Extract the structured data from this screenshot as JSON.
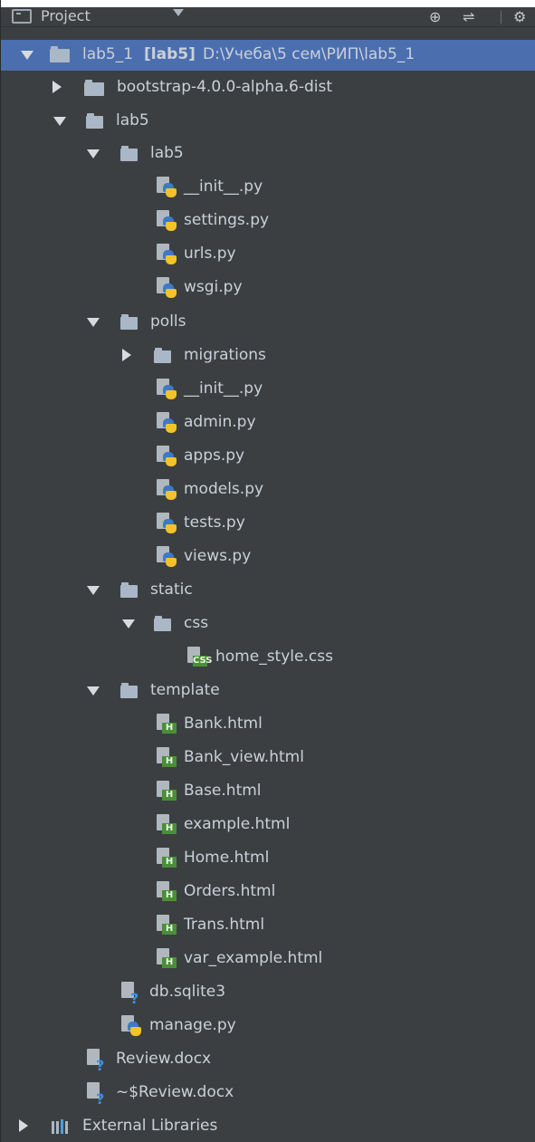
{
  "toolbar": {
    "title": "Project",
    "icons": [
      "target-icon",
      "filter-icon",
      "gear-icon"
    ]
  },
  "tree": {
    "root": {
      "name": "lab5_1",
      "module": "[lab5]",
      "path": "D:\\Учеба\\5 сем\\РИП\\lab5_1"
    },
    "items": [
      {
        "label": "bootstrap-4.0.0-alpha.6-dist"
      },
      {
        "label": "lab5"
      },
      {
        "label": "lab5"
      },
      {
        "label": "__init__.py"
      },
      {
        "label": "settings.py"
      },
      {
        "label": "urls.py"
      },
      {
        "label": "wsgi.py"
      },
      {
        "label": "polls"
      },
      {
        "label": "migrations"
      },
      {
        "label": "__init__.py"
      },
      {
        "label": "admin.py"
      },
      {
        "label": "apps.py"
      },
      {
        "label": "models.py"
      },
      {
        "label": "tests.py"
      },
      {
        "label": "views.py"
      },
      {
        "label": "static"
      },
      {
        "label": "css"
      },
      {
        "label": "home_style.css"
      },
      {
        "label": "template"
      },
      {
        "label": "Bank.html"
      },
      {
        "label": "Bank_view.html"
      },
      {
        "label": "Base.html"
      },
      {
        "label": "example.html"
      },
      {
        "label": "Home.html"
      },
      {
        "label": "Orders.html"
      },
      {
        "label": "Trans.html"
      },
      {
        "label": "var_example.html"
      },
      {
        "label": "db.sqlite3"
      },
      {
        "label": "manage.py"
      },
      {
        "label": "Review.docx"
      },
      {
        "label": "~$Review.docx"
      },
      {
        "label": "External Libraries"
      }
    ],
    "badges": {
      "css": "CSS",
      "html": "H"
    }
  },
  "colors": {
    "background": "#3c3f41",
    "selection": "#4b6eaf",
    "folder": "#a9b7c6",
    "python_blue": "#3f79c6",
    "python_yellow": "#f3c329",
    "badge_green": "#4a8f38",
    "question": "#3b8fe2"
  }
}
